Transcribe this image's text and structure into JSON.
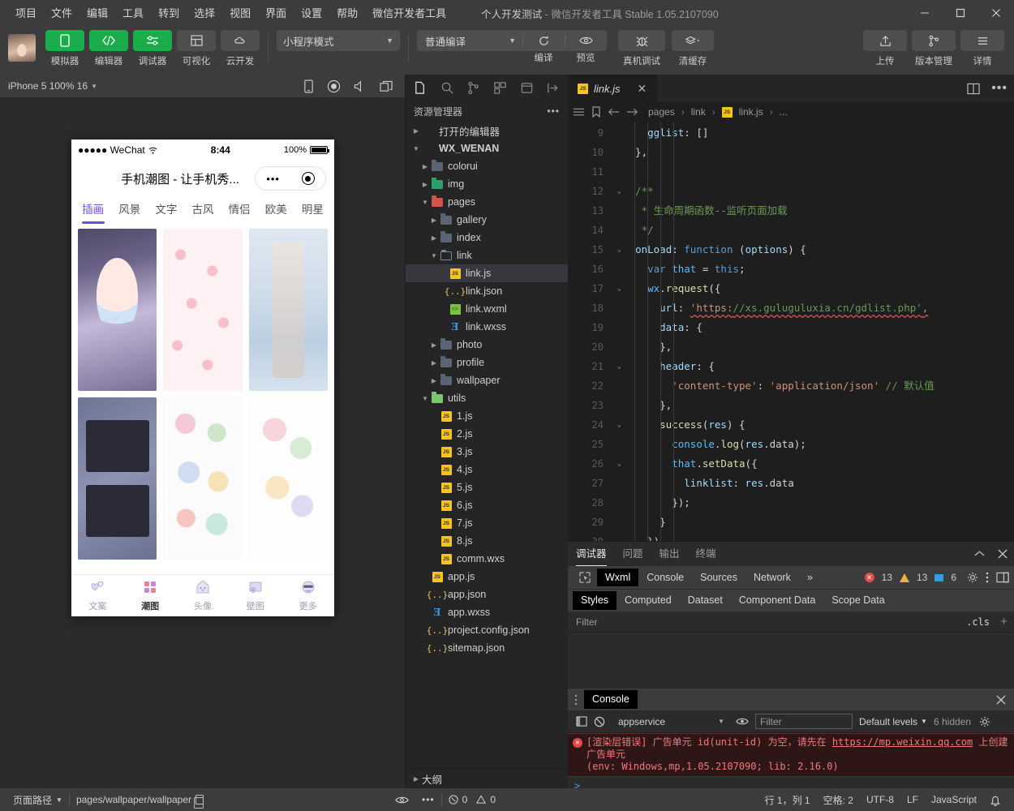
{
  "titlebar": {
    "menus": [
      "项目",
      "文件",
      "编辑",
      "工具",
      "转到",
      "选择",
      "视图",
      "界面",
      "设置",
      "帮助",
      "微信开发者工具"
    ],
    "project_name": "个人开发测试",
    "separator": "-",
    "app_name": "微信开发者工具 Stable 1.05.2107090",
    "window_controls": {
      "minimize": "minimize-icon",
      "maximize": "maximize-icon",
      "close": "close-icon"
    }
  },
  "toolbar": {
    "tools": [
      {
        "label": "模拟器",
        "icon": "phone-icon",
        "style": "green"
      },
      {
        "label": "编辑器",
        "icon": "code-icon",
        "style": "green"
      },
      {
        "label": "调试器",
        "icon": "sliders-icon",
        "style": "green"
      },
      {
        "label": "可视化",
        "icon": "layout-icon",
        "style": "grey"
      },
      {
        "label": "云开发",
        "icon": "cloud-icon",
        "style": "grey"
      }
    ],
    "mode_select": "小程序模式",
    "compile_select": "普通编译",
    "compile_label": "编译",
    "preview_label": "预览",
    "realdevice_label": "真机调试",
    "clearcache_label": "清缓存",
    "right_buttons": [
      {
        "label": "上传",
        "icon": "upload-icon"
      },
      {
        "label": "版本管理",
        "icon": "branch-icon"
      },
      {
        "label": "详情",
        "icon": "menu-icon"
      }
    ]
  },
  "simulator": {
    "device_label": "iPhone 5 100% 16",
    "toolbar_icons": [
      "rotate-icon",
      "record-icon",
      "volume-icon",
      "windows-icon"
    ],
    "phone": {
      "status": {
        "carrier": "●●●●● WeChat",
        "wifi": "wifi-icon",
        "time": "8:44",
        "battery_pct": "100%"
      },
      "nav_title": "手机潮图 - 让手机秀...",
      "capsule": {
        "dots": "•••",
        "target": "target-icon"
      },
      "category_tabs": [
        {
          "label": "插画",
          "active": true
        },
        {
          "label": "风景",
          "active": false
        },
        {
          "label": "文字",
          "active": false
        },
        {
          "label": "古风",
          "active": false
        },
        {
          "label": "情侣",
          "active": false
        },
        {
          "label": "欧美",
          "active": false
        },
        {
          "label": "明星",
          "active": false
        }
      ],
      "tabbar": [
        {
          "label": "文案",
          "icon": "hearts-icon",
          "active": false
        },
        {
          "label": "潮图",
          "icon": "grid-icon",
          "active": true
        },
        {
          "label": "头像",
          "icon": "house-icon",
          "active": false
        },
        {
          "label": "壁图",
          "icon": "frame-icon",
          "active": false
        },
        {
          "label": "更多",
          "icon": "emoji-icon",
          "active": false
        }
      ]
    }
  },
  "explorer": {
    "activity_icons": [
      "files-icon",
      "search-icon",
      "source-control-icon",
      "extensions-icon",
      "debug-icon",
      "collapse-icon"
    ],
    "title": "资源管理器",
    "more_icon": "ellipsis-icon",
    "tree": [
      {
        "label": "打开的编辑器",
        "depth": 0,
        "type": "section",
        "arrow": "right",
        "selected": false
      },
      {
        "label": "WX_WENAN",
        "depth": 0,
        "type": "root",
        "arrow": "down",
        "selected": false
      },
      {
        "label": "colorui",
        "depth": 1,
        "type": "folder",
        "arrow": "right",
        "selected": false
      },
      {
        "label": "img",
        "depth": 1,
        "type": "folder-green",
        "arrow": "right",
        "selected": false
      },
      {
        "label": "pages",
        "depth": 1,
        "type": "folder-red",
        "arrow": "down",
        "selected": false
      },
      {
        "label": "gallery",
        "depth": 2,
        "type": "folder",
        "arrow": "right",
        "selected": false
      },
      {
        "label": "index",
        "depth": 2,
        "type": "folder",
        "arrow": "right",
        "selected": false
      },
      {
        "label": "link",
        "depth": 2,
        "type": "folder-open",
        "arrow": "down",
        "selected": false
      },
      {
        "label": "link.js",
        "depth": 3,
        "type": "js",
        "arrow": "",
        "selected": true
      },
      {
        "label": "link.json",
        "depth": 3,
        "type": "json",
        "arrow": "",
        "selected": false
      },
      {
        "label": "link.wxml",
        "depth": 3,
        "type": "wxml",
        "arrow": "",
        "selected": false
      },
      {
        "label": "link.wxss",
        "depth": 3,
        "type": "wxss",
        "arrow": "",
        "selected": false
      },
      {
        "label": "photo",
        "depth": 2,
        "type": "folder",
        "arrow": "right",
        "selected": false
      },
      {
        "label": "profile",
        "depth": 2,
        "type": "folder",
        "arrow": "right",
        "selected": false
      },
      {
        "label": "wallpaper",
        "depth": 2,
        "type": "folder",
        "arrow": "right",
        "selected": false
      },
      {
        "label": "utils",
        "depth": 1,
        "type": "folder-lgreen",
        "arrow": "down",
        "selected": false
      },
      {
        "label": "1.js",
        "depth": 2,
        "type": "js",
        "arrow": "",
        "selected": false
      },
      {
        "label": "2.js",
        "depth": 2,
        "type": "js",
        "arrow": "",
        "selected": false
      },
      {
        "label": "3.js",
        "depth": 2,
        "type": "js",
        "arrow": "",
        "selected": false
      },
      {
        "label": "4.js",
        "depth": 2,
        "type": "js",
        "arrow": "",
        "selected": false
      },
      {
        "label": "5.js",
        "depth": 2,
        "type": "js",
        "arrow": "",
        "selected": false
      },
      {
        "label": "6.js",
        "depth": 2,
        "type": "js",
        "arrow": "",
        "selected": false
      },
      {
        "label": "7.js",
        "depth": 2,
        "type": "js",
        "arrow": "",
        "selected": false
      },
      {
        "label": "8.js",
        "depth": 2,
        "type": "js",
        "arrow": "",
        "selected": false
      },
      {
        "label": "comm.wxs",
        "depth": 2,
        "type": "js",
        "arrow": "",
        "selected": false
      },
      {
        "label": "app.js",
        "depth": 1,
        "type": "js",
        "arrow": "",
        "selected": false
      },
      {
        "label": "app.json",
        "depth": 1,
        "type": "json",
        "arrow": "",
        "selected": false
      },
      {
        "label": "app.wxss",
        "depth": 1,
        "type": "wxss",
        "arrow": "",
        "selected": false
      },
      {
        "label": "project.config.json",
        "depth": 1,
        "type": "json",
        "arrow": "",
        "selected": false
      },
      {
        "label": "sitemap.json",
        "depth": 1,
        "type": "json",
        "arrow": "",
        "selected": false
      }
    ],
    "outline_label": "大纲"
  },
  "editor": {
    "tab": {
      "filename": "link.js",
      "icon": "js-icon",
      "close": "close-icon"
    },
    "split_icon": "split-editor-icon",
    "more_icon": "ellipsis-icon",
    "breadcrumb": {
      "icons": [
        "list-icon",
        "bookmark-icon",
        "back-icon",
        "forward-icon"
      ],
      "path": [
        "pages",
        "link",
        "link.js",
        "..."
      ]
    },
    "lines": [
      {
        "num": "9",
        "fold": "",
        "text": "    gglist: []"
      },
      {
        "num": "10",
        "fold": "",
        "text": "  },"
      },
      {
        "num": "11",
        "fold": "",
        "text": ""
      },
      {
        "num": "12",
        "fold": "down",
        "text": "  /**"
      },
      {
        "num": "13",
        "fold": "",
        "text": "   * 生命周期函数--监听页面加载"
      },
      {
        "num": "14",
        "fold": "",
        "text": "   */"
      },
      {
        "num": "15",
        "fold": "down",
        "text": "  onLoad: function (options) {"
      },
      {
        "num": "16",
        "fold": "",
        "text": "    var that = this;"
      },
      {
        "num": "17",
        "fold": "down",
        "text": "    wx.request({"
      },
      {
        "num": "18",
        "fold": "",
        "text": "      url: 'https://xs.guluguluxia.cn/gdlist.php',"
      },
      {
        "num": "19",
        "fold": "",
        "text": "      data: {"
      },
      {
        "num": "20",
        "fold": "",
        "text": "      },"
      },
      {
        "num": "21",
        "fold": "down",
        "text": "      header: {"
      },
      {
        "num": "22",
        "fold": "",
        "text": "        'content-type': 'application/json' // 默认值"
      },
      {
        "num": "23",
        "fold": "",
        "text": "      },"
      },
      {
        "num": "24",
        "fold": "down",
        "text": "      success(res) {"
      },
      {
        "num": "25",
        "fold": "",
        "text": "        console.log(res.data);"
      },
      {
        "num": "26",
        "fold": "down",
        "text": "        that.setData({"
      },
      {
        "num": "27",
        "fold": "",
        "text": "          linklist: res.data"
      },
      {
        "num": "28",
        "fold": "",
        "text": "        });"
      },
      {
        "num": "29",
        "fold": "",
        "text": "      }"
      },
      {
        "num": "30",
        "fold": "",
        "text": "    })"
      }
    ],
    "code_url": "https://xs.guluguluxia.cn/gdlist.php"
  },
  "debugger": {
    "panel_tabs": [
      {
        "label": "调试器",
        "active": true
      },
      {
        "label": "问题",
        "active": false
      },
      {
        "label": "输出",
        "active": false
      },
      {
        "label": "终端",
        "active": false
      }
    ],
    "panel_controls": [
      "chevron-up-icon",
      "close-icon"
    ],
    "devtools_tabs": [
      {
        "label": "Wxml",
        "active": true
      },
      {
        "label": "Console",
        "active": false
      },
      {
        "label": "Sources",
        "active": false
      },
      {
        "label": "Network",
        "active": false
      },
      {
        "label": "»",
        "active": false
      }
    ],
    "inspect_icon": "inspect-icon",
    "counts": {
      "errors": "13",
      "warnings": "13",
      "infos": "6"
    },
    "devtools_right_icons": [
      "gear-icon",
      "kebab-icon",
      "dock-icon"
    ],
    "styles_tabs": [
      {
        "label": "Styles",
        "active": true
      },
      {
        "label": "Computed",
        "active": false
      },
      {
        "label": "Dataset",
        "active": false
      },
      {
        "label": "Component Data",
        "active": false
      },
      {
        "label": "Scope Data",
        "active": false
      }
    ],
    "filter_placeholder": "Filter",
    "cls_label": ".cls",
    "add_rule_icon": "plus-icon",
    "console": {
      "title": "Console",
      "drag_icon": "drag-handle-icon",
      "close_icon": "close-icon",
      "sidebar_icon": "sidebar-icon",
      "clear_icon": "clear-icon",
      "context": "appservice",
      "eye_icon": "eye-icon",
      "filter_placeholder": "Filter",
      "levels": "Default levels",
      "hidden": "6 hidden",
      "settings_icon": "gear-icon",
      "message": {
        "prefix": "[渲染层错误] 广告单元 id(unit-id) 为空，请先在 ",
        "link": "https://mp.weixin.qq.com",
        "suffix": " 上创建广告单元",
        "env": "(env: Windows,mp,1.05.2107090; lib: 2.16.0)"
      },
      "prompt": ">"
    }
  },
  "statusbar": {
    "page_path_label": "页面路径",
    "page_path_value": "pages/wallpaper/wallpaper",
    "copy_icon": "copy-icon",
    "eye_icon": "eye-icon",
    "more_icon": "ellipsis-icon",
    "error_count": "0",
    "warning_count": "0",
    "cursor": "行 1，列 1",
    "spaces": "空格: 2",
    "encoding": "UTF-8",
    "eol": "LF",
    "language": "JavaScript",
    "bell_icon": "bell-icon"
  },
  "colors": {
    "accent_green": "#1aad4b",
    "titlebar_bg": "#3c3c3c",
    "editor_bg": "#1e1e1e",
    "explorer_bg": "#252526",
    "error_red": "#e04a4a",
    "tab_purple": "#6f4fd8"
  }
}
